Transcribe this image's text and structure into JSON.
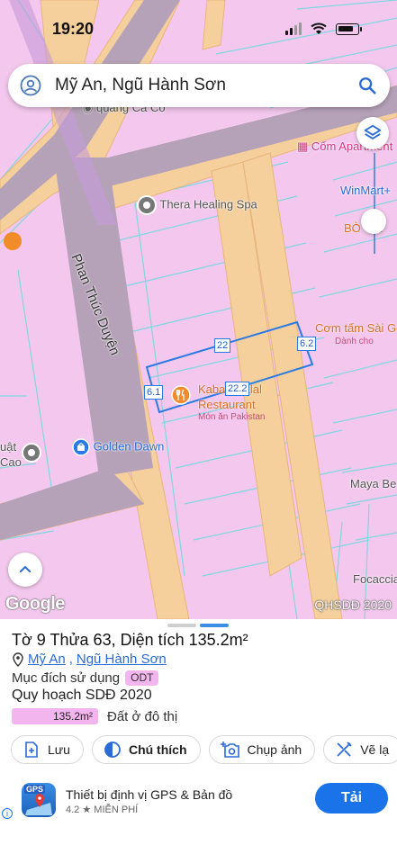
{
  "status": {
    "time": "19:20"
  },
  "search": {
    "query": "Mỹ An, Ngũ Hành Sơn"
  },
  "map": {
    "street_name": "Phan Thúc Duyện",
    "pois": {
      "quang_ca_co": "quang Ca Co",
      "com_apartment": "Cốm Apartment",
      "thera": "Thera Healing Spa",
      "winmart": "WinMart+",
      "bo_cat": "BÒ Cat",
      "com_tam": "Cơm tấm Sài Go",
      "com_tam_sub": "Dành cho",
      "kabab_1": "Kabab Halal",
      "kabab_2": "Restaurant",
      "kabab_sub": "Món ăn Pakistan",
      "golden_dawn": "Golden Dawn",
      "uat": "uật",
      "cao": "Cao",
      "maya": "Maya Be",
      "focaccia": "Focaccia"
    },
    "dimensions": {
      "top": "22",
      "right": "6.2",
      "bottom": "22.2",
      "left": "6.1"
    },
    "logo": "Google",
    "layer_label": "QHSDĐ 2020",
    "colors": {
      "land": "#f4c8ee",
      "road": "#f5cf9c",
      "parcel_outline": "#2a7be4"
    }
  },
  "sheet": {
    "title": "Tờ 9 Thửa 63, Diện tích 135.2m²",
    "ward": "Mỹ An",
    "separator": ",",
    "district": "Ngũ Hành Sơn",
    "purpose_label": "Mục đích sử dụng",
    "purpose_code": "ODT",
    "plan_title": "Quy hoạch SDĐ 2020",
    "plan_area": "135.2m²",
    "plan_desc": "Đất ở đô thị",
    "actions": {
      "save": "Lưu",
      "notes": "Chú thích",
      "screenshot": "Chụp ảnh",
      "draw": "Vẽ lạ"
    }
  },
  "ad": {
    "title": "Thiết bị định vị GPS & Bản đồ",
    "rating": "4.2",
    "price": "MIỄN PHÍ",
    "install_label": "Tải",
    "icon_text": "GPS"
  }
}
